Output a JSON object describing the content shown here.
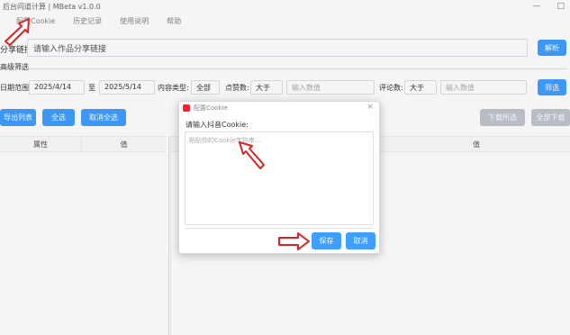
{
  "window": {
    "title": "后台问道计算 | MBeta v1.0.0",
    "min": "—",
    "max": "□"
  },
  "menu": {
    "items": [
      "配置Cookie",
      "历史记录",
      "使用说明",
      "帮助"
    ]
  },
  "url": {
    "label": "分享链接:",
    "placeholder": "请输入作品分享链接"
  },
  "parse_button": "解析",
  "filter": {
    "title": "高级筛选",
    "date_label": "日期范围:",
    "date_from": "2025/4/14",
    "to": "至",
    "date_to": "2025/5/14",
    "type_label": "内容类型:",
    "type_value": "全部",
    "likes_label": "点赞数:",
    "likes_op": "大于",
    "likes_placeholder": "输入数值",
    "comments_label": "评论数:",
    "comments_op": "大于",
    "comments_placeholder": "输入数值",
    "button": "筛选"
  },
  "actions": {
    "export": "导出列表",
    "select_all": "全选",
    "deselect": "取消全选",
    "download_selected": "下载所选",
    "download_all": "全部下载"
  },
  "table_left": {
    "col1": "属性",
    "col2": "值"
  },
  "table_right": {
    "col1": "值"
  },
  "dialog": {
    "title": "配置Cookie",
    "close": "×",
    "label": "请输入抖音Cookie:",
    "placeholder": "粘贴你的Cookie字符串...",
    "save": "保存",
    "cancel": "取消"
  },
  "colors": {
    "primary": "#409eff",
    "annotation": "#e02020"
  }
}
